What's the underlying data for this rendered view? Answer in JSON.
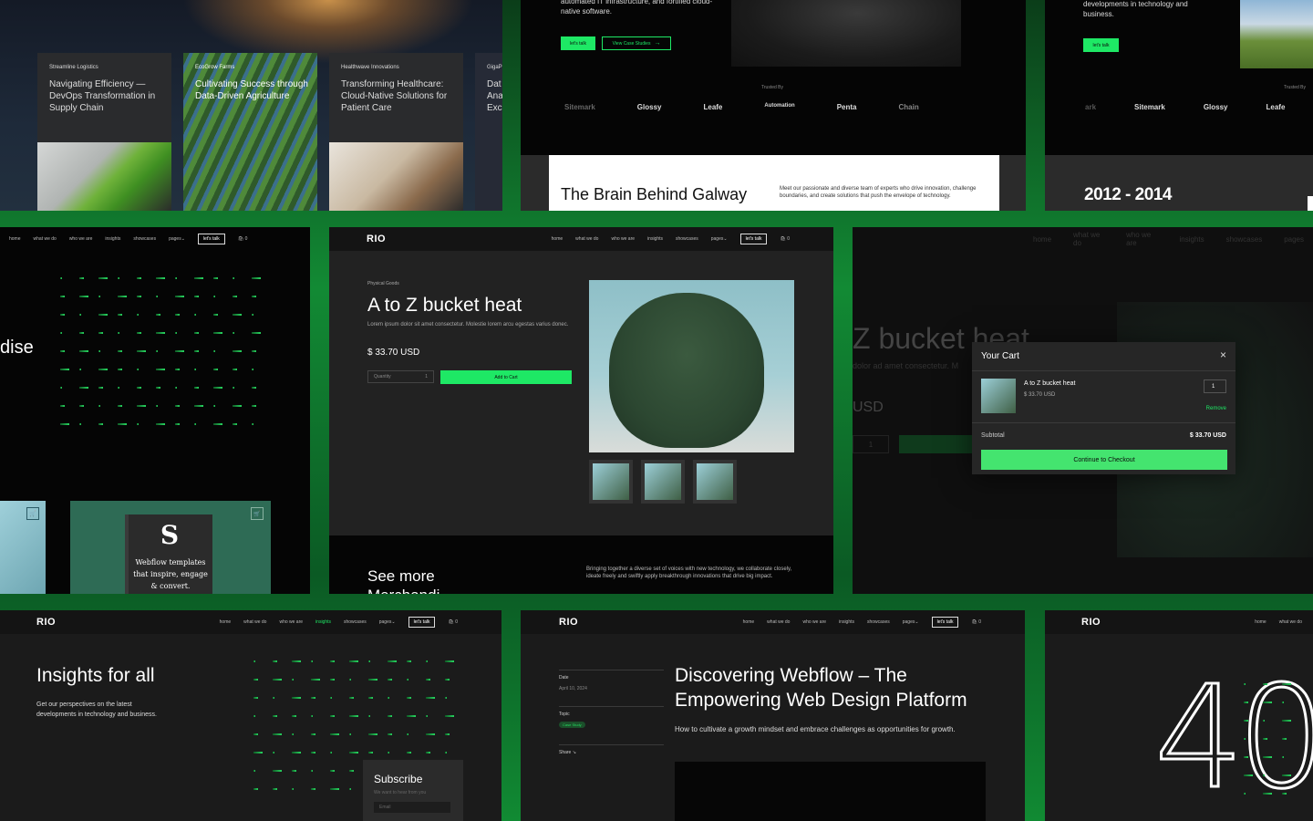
{
  "brand": {
    "logo": "RIO",
    "accent": "#1ee865",
    "frame": "#128a34"
  },
  "nav": {
    "home": "home",
    "what": "what we do",
    "who": "who we are",
    "insights": "insights",
    "showcases": "showcases",
    "pages": "pages",
    "talk": "let's talk",
    "cart_count": "0"
  },
  "cases": [
    {
      "client": "Streamline Logistics",
      "title": "Navigating Efficiency — DevOps Transformation in Supply Chain"
    },
    {
      "client": "EcoGrow Farms",
      "title": "Cultivating Success through Data-Driven Agriculture"
    },
    {
      "client": "Healthwave Innovations",
      "title": "Transforming Healthcare: Cloud-Native Solutions for Patient Care"
    },
    {
      "client": "GigaP",
      "title": "Dat Ana Exc"
    }
  ],
  "top_mid": {
    "text": "automated IT infrastructure, and fortified cloud-native software.",
    "btn1": "let's talk",
    "btn2": "View Case Studies",
    "trusted": "Trusted By",
    "logos": [
      "Sitemark",
      "Glossy",
      "Leafe",
      "Automation",
      "Penta",
      "Chain"
    ],
    "brain_title": "The Brain Behind Galway",
    "brain_text": "Meet our passionate and diverse team of experts who drive innovation, challenge boundaries, and create solutions that push the envelope of technology."
  },
  "top_right": {
    "text": "developments in technology and business.",
    "btn": "let's talk",
    "trusted": "Trusted By",
    "logos": [
      "ark",
      "Sitemark",
      "Glossy",
      "Leafe"
    ],
    "years": "2012 - 2014"
  },
  "mid_left": {
    "word": "dise",
    "book_lines": [
      "Webflow templates",
      "that inspire, engage",
      "& convert."
    ]
  },
  "product": {
    "category": "Physical Goods",
    "title": "A to Z bucket heat",
    "desc": "Lorem ipsum dolor sit amet consectetur. Molestie lorem arcu egestas varius donec.",
    "price": "$ 33.70 USD",
    "qty_label": "Quantity",
    "qty": "1",
    "add": "Add to Cart",
    "see_more": "See more",
    "see_more2": "Merchandi",
    "blurb": "Bringing together a diverse set of voices with new technology, we collaborate closely, ideate freely and swiftly apply breakthrough innovations that drive big impact."
  },
  "cart": {
    "bg_title": "Z bucket heat",
    "bg_sub": "dolor ad amet consectetur. M",
    "bg_price": "USD",
    "bg_qty": "1",
    "title": "Your Cart",
    "close": "×",
    "item": "A to Z bucket heat",
    "item_price": "$ 33.70 USD",
    "qty": "1",
    "remove": "Remove",
    "subtotal_label": "Subtotal",
    "subtotal": "$ 33.70 USD",
    "checkout": "Continue to Checkout"
  },
  "insights": {
    "title": "Insights for all",
    "text": "Get our perspectives on the latest developments in technology and business.",
    "subscribe": "Subscribe",
    "sub_text": "We want to hear from you",
    "email": "Email"
  },
  "blog": {
    "date_label": "Date",
    "date": "April 10, 2024",
    "topic_label": "Topic",
    "topic": "Case Study",
    "share": "Share",
    "title": "Discovering Webflow – The Empowering Web Design Platform",
    "sub": "How to cultivate a growth mindset and embrace challenges as opportunities for growth."
  },
  "forty": {
    "digits": "40"
  }
}
